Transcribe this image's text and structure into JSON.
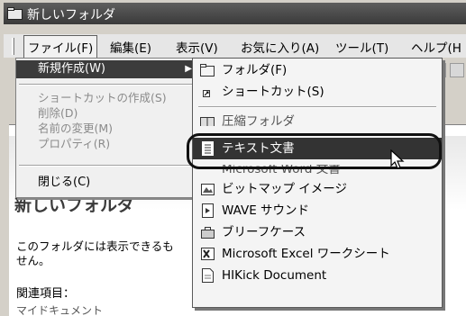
{
  "window": {
    "title": "新しいフォルダ"
  },
  "menubar": {
    "items": [
      {
        "label": "ファイル(F)"
      },
      {
        "label": "編集(E)"
      },
      {
        "label": "表示(V)"
      },
      {
        "label": "お気に入り(A)"
      },
      {
        "label": "ツール(T)"
      },
      {
        "label": "ヘルプ(H"
      }
    ]
  },
  "file_menu": {
    "new": "新規作成(W)",
    "create_shortcut": "ショートカットの作成(S)",
    "delete": "削除(D)",
    "rename": "名前の変更(M)",
    "properties": "プロパティ(R)",
    "close": "閉じる(C)"
  },
  "new_submenu": {
    "folder": "フォルダ(F)",
    "shortcut": "ショートカット(S)",
    "compressed_folder": "圧縮フォルダ",
    "text_document": "テキスト文書",
    "word_document": "Microsoft Word 文書",
    "bitmap_image": "ビットマップ イメージ",
    "wave_sound": "WAVE サウンド",
    "briefcase": "ブリーフケース",
    "excel_worksheet": "Microsoft Excel ワークシート",
    "hikick_document": "HIKick Document"
  },
  "explorer": {
    "folder_title": "新しいフォルダ",
    "description_line1": "このフォルダには表示できるも",
    "description_line2": "せん。",
    "related": "関連項目：",
    "my_documents": "マイドキュメント"
  },
  "colors": {
    "highlight": "#333333",
    "menu_bg": "#f4f4f4",
    "title_bg": "#4a4a4a"
  }
}
